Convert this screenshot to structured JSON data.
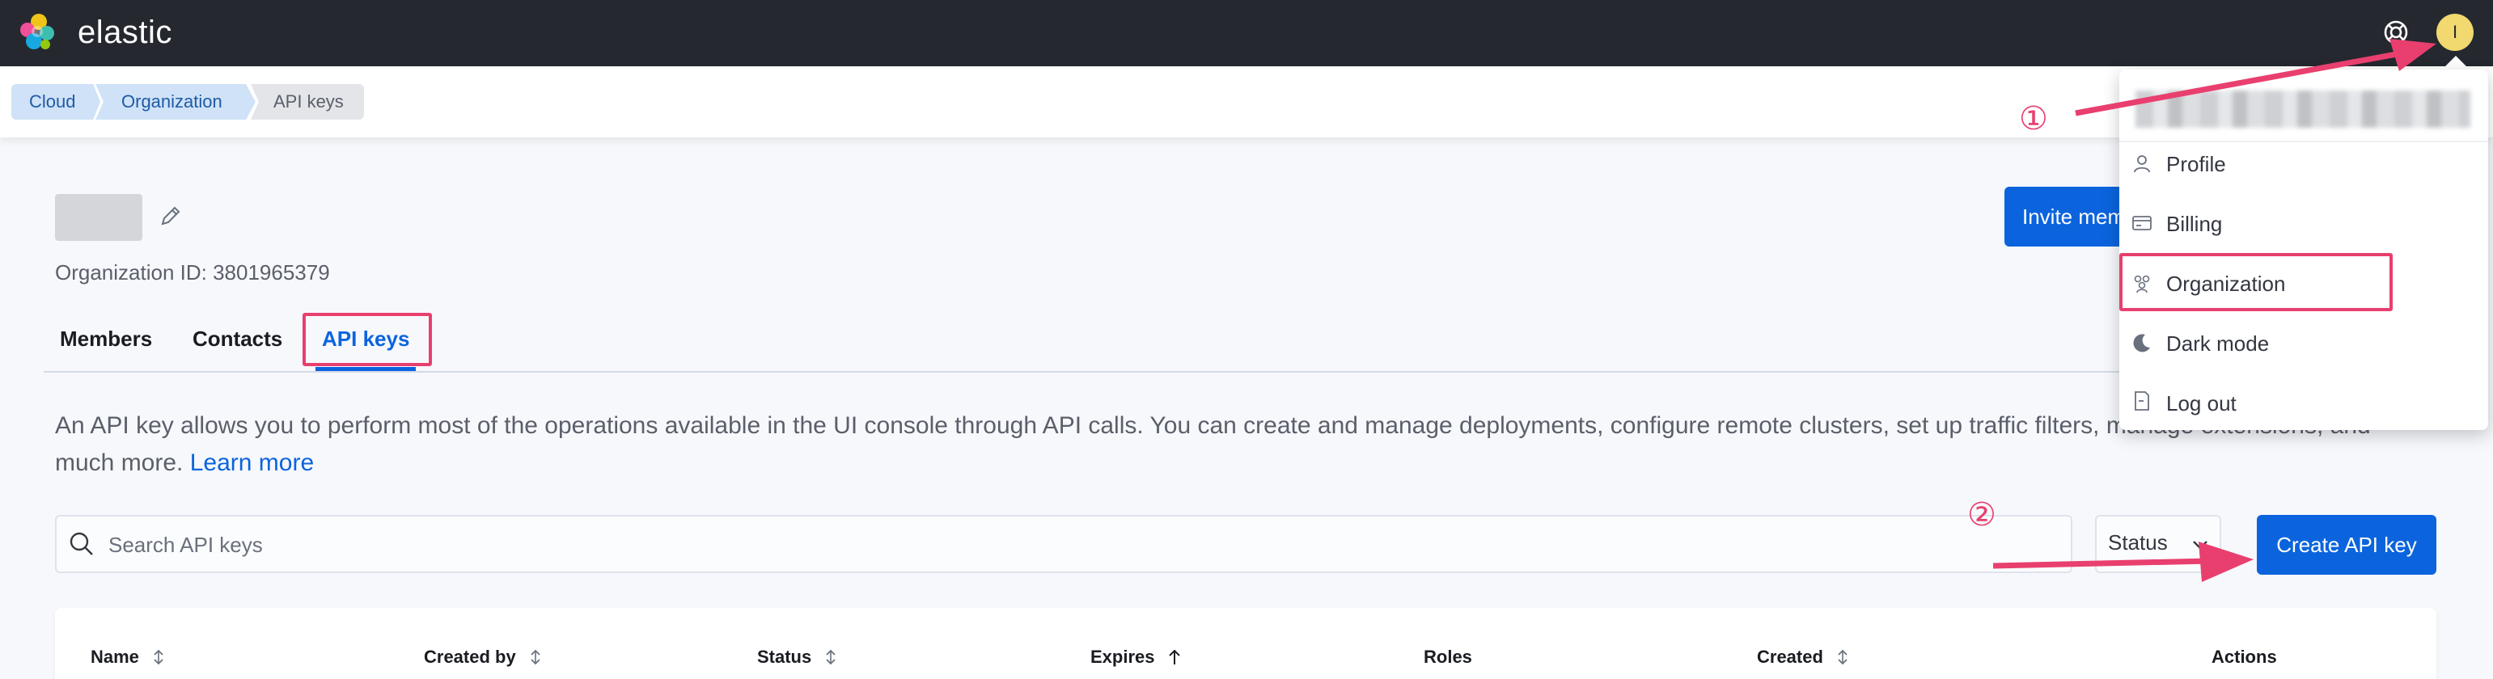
{
  "header": {
    "brand": "elastic",
    "avatar_initial": "I"
  },
  "breadcrumb": [
    "Cloud",
    "Organization",
    "API keys"
  ],
  "organization": {
    "id_text": "Organization ID: 3801965379"
  },
  "tabs": [
    {
      "label": "Members"
    },
    {
      "label": "Contacts"
    },
    {
      "label": "API keys",
      "active": true
    }
  ],
  "intro": {
    "text": "An API key allows you to perform most of the operations available in the UI console through API calls. You can create and manage deployments, configure remote clusters, set up traffic filters, manage extensions, and much more.",
    "link": "Learn more"
  },
  "search": {
    "placeholder": "Search API keys"
  },
  "filters": {
    "status_label": "Status"
  },
  "buttons": {
    "create_api_key": "Create API key",
    "invite_members": "Invite members"
  },
  "table": {
    "columns": [
      {
        "label": "Name",
        "sort": "both"
      },
      {
        "label": "Created by",
        "sort": "both"
      },
      {
        "label": "Status",
        "sort": "both"
      },
      {
        "label": "Expires",
        "sort": "asc"
      },
      {
        "label": "Roles",
        "sort": "none"
      },
      {
        "label": "Created",
        "sort": "both"
      },
      {
        "label": "Actions",
        "sort": "none"
      }
    ]
  },
  "user_menu": {
    "items": [
      {
        "label": "Profile",
        "icon": "user-icon"
      },
      {
        "label": "Billing",
        "icon": "credit-card-icon"
      },
      {
        "label": "Organization",
        "icon": "users-icon"
      },
      {
        "label": "Dark mode",
        "icon": "moon-icon"
      },
      {
        "label": "Log out",
        "icon": "exit-icon"
      }
    ]
  },
  "annotations": {
    "marker_1": "①",
    "marker_2": "②",
    "color": "#e83f6f"
  },
  "colors": {
    "header_bg": "#25282f",
    "primary": "#0b64dd",
    "avatar_bg": "#f1d86f"
  }
}
